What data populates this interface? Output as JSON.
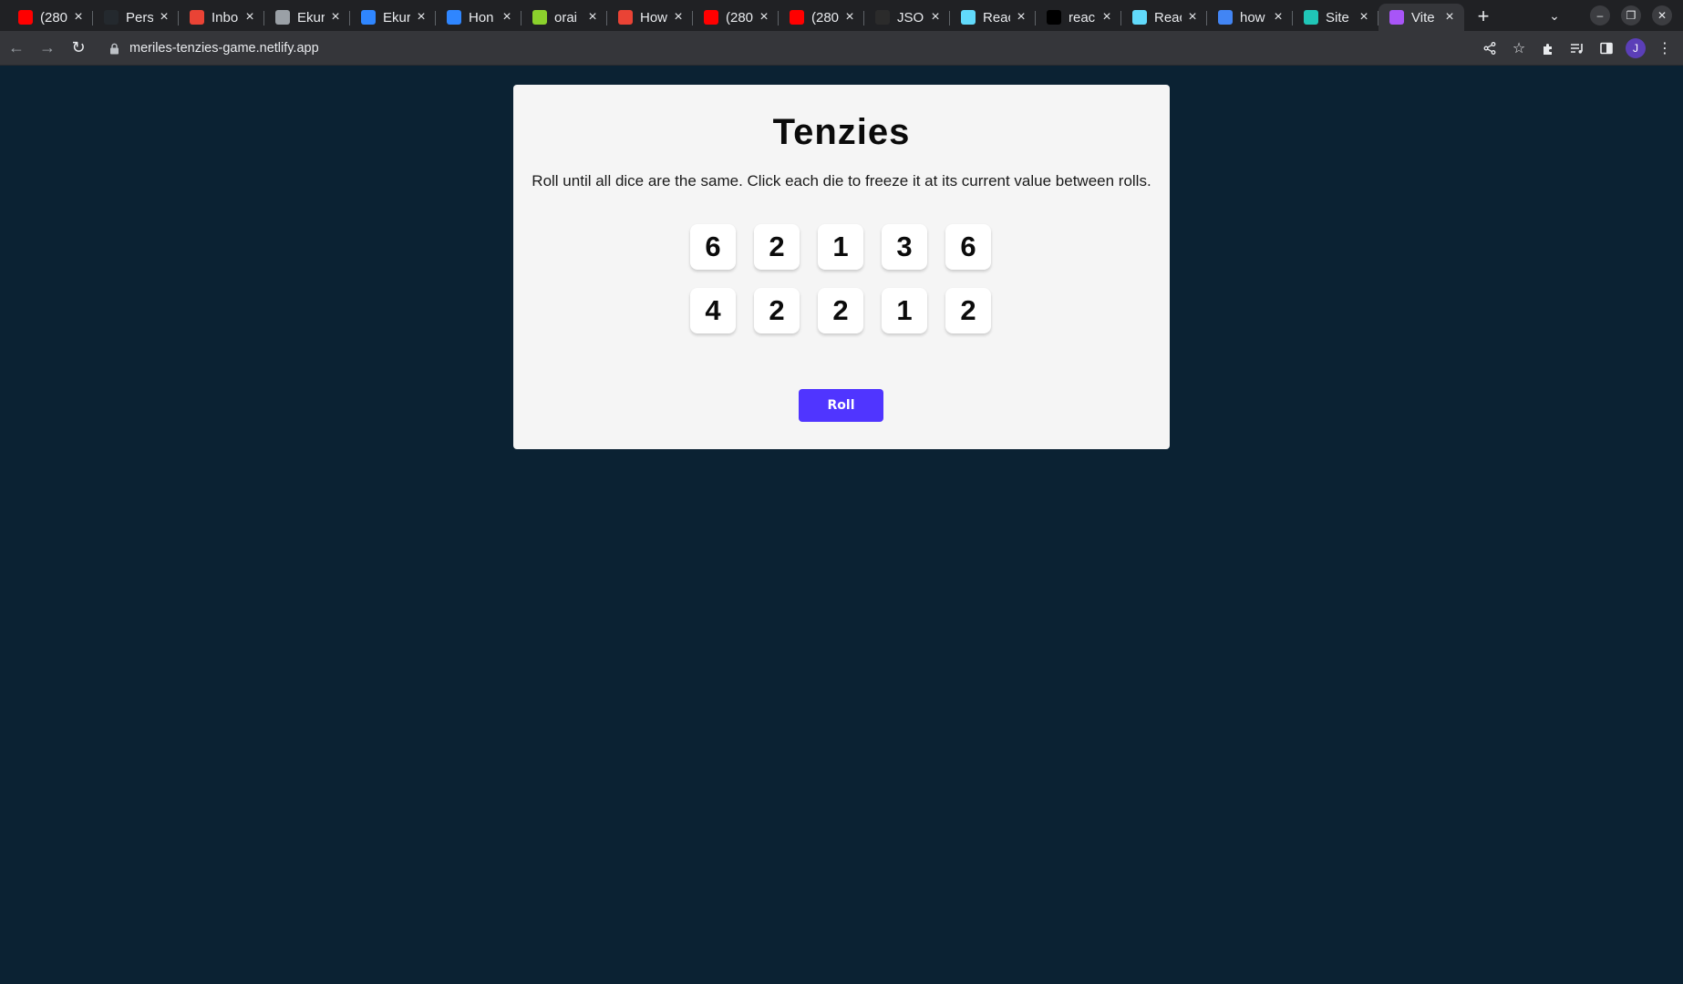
{
  "browser": {
    "tabs": [
      {
        "title": "(280",
        "favicon": "youtube-icon",
        "color": "#ff0000"
      },
      {
        "title": "Pers",
        "favicon": "github-icon",
        "color": "#24292e"
      },
      {
        "title": "Inbo",
        "favicon": "gmail-icon",
        "color": "#ea4335"
      },
      {
        "title": "Ekur",
        "favicon": "image-icon",
        "color": "#9aa0a6"
      },
      {
        "title": "Ekur",
        "favicon": "canva-icon",
        "color": "#2f86ff"
      },
      {
        "title": "Hon",
        "favicon": "canva-icon",
        "color": "#2f86ff"
      },
      {
        "title": "orai",
        "favicon": "ring-icon",
        "color": "#8bd12c"
      },
      {
        "title": "How",
        "favicon": "gmail-icon",
        "color": "#ea4335"
      },
      {
        "title": "(280",
        "favicon": "youtube-icon",
        "color": "#ff0000"
      },
      {
        "title": "(280",
        "favicon": "youtube-icon",
        "color": "#ff0000"
      },
      {
        "title": "JSOI",
        "favicon": "json-icon",
        "color": "#2b2b2b"
      },
      {
        "title": "Reac",
        "favicon": "react-icon",
        "color": "#61dafb"
      },
      {
        "title": "reac",
        "favicon": "vercel-icon",
        "color": "#000000"
      },
      {
        "title": "Reac",
        "favicon": "react-icon",
        "color": "#61dafb"
      },
      {
        "title": "how",
        "favicon": "google-icon",
        "color": "#4285f4"
      },
      {
        "title": "Site",
        "favicon": "netlify-icon",
        "color": "#20c6b7"
      },
      {
        "title": "Vite",
        "favicon": "vite-icon",
        "color": "#a855f7",
        "active": true
      }
    ],
    "url": "meriles-tenzies-game.netlify.app",
    "profile_initial": "J"
  },
  "game": {
    "title": "Tenzies",
    "instructions": "Roll until all dice are the same. Click each die to freeze it at its current value between rolls.",
    "dice": [
      6,
      2,
      1,
      3,
      6,
      4,
      2,
      2,
      1,
      2
    ],
    "roll_label": "Roll"
  },
  "colors": {
    "page_background": "#0b2233",
    "card_background": "#f5f5f5",
    "roll_button": "#5035ff"
  }
}
